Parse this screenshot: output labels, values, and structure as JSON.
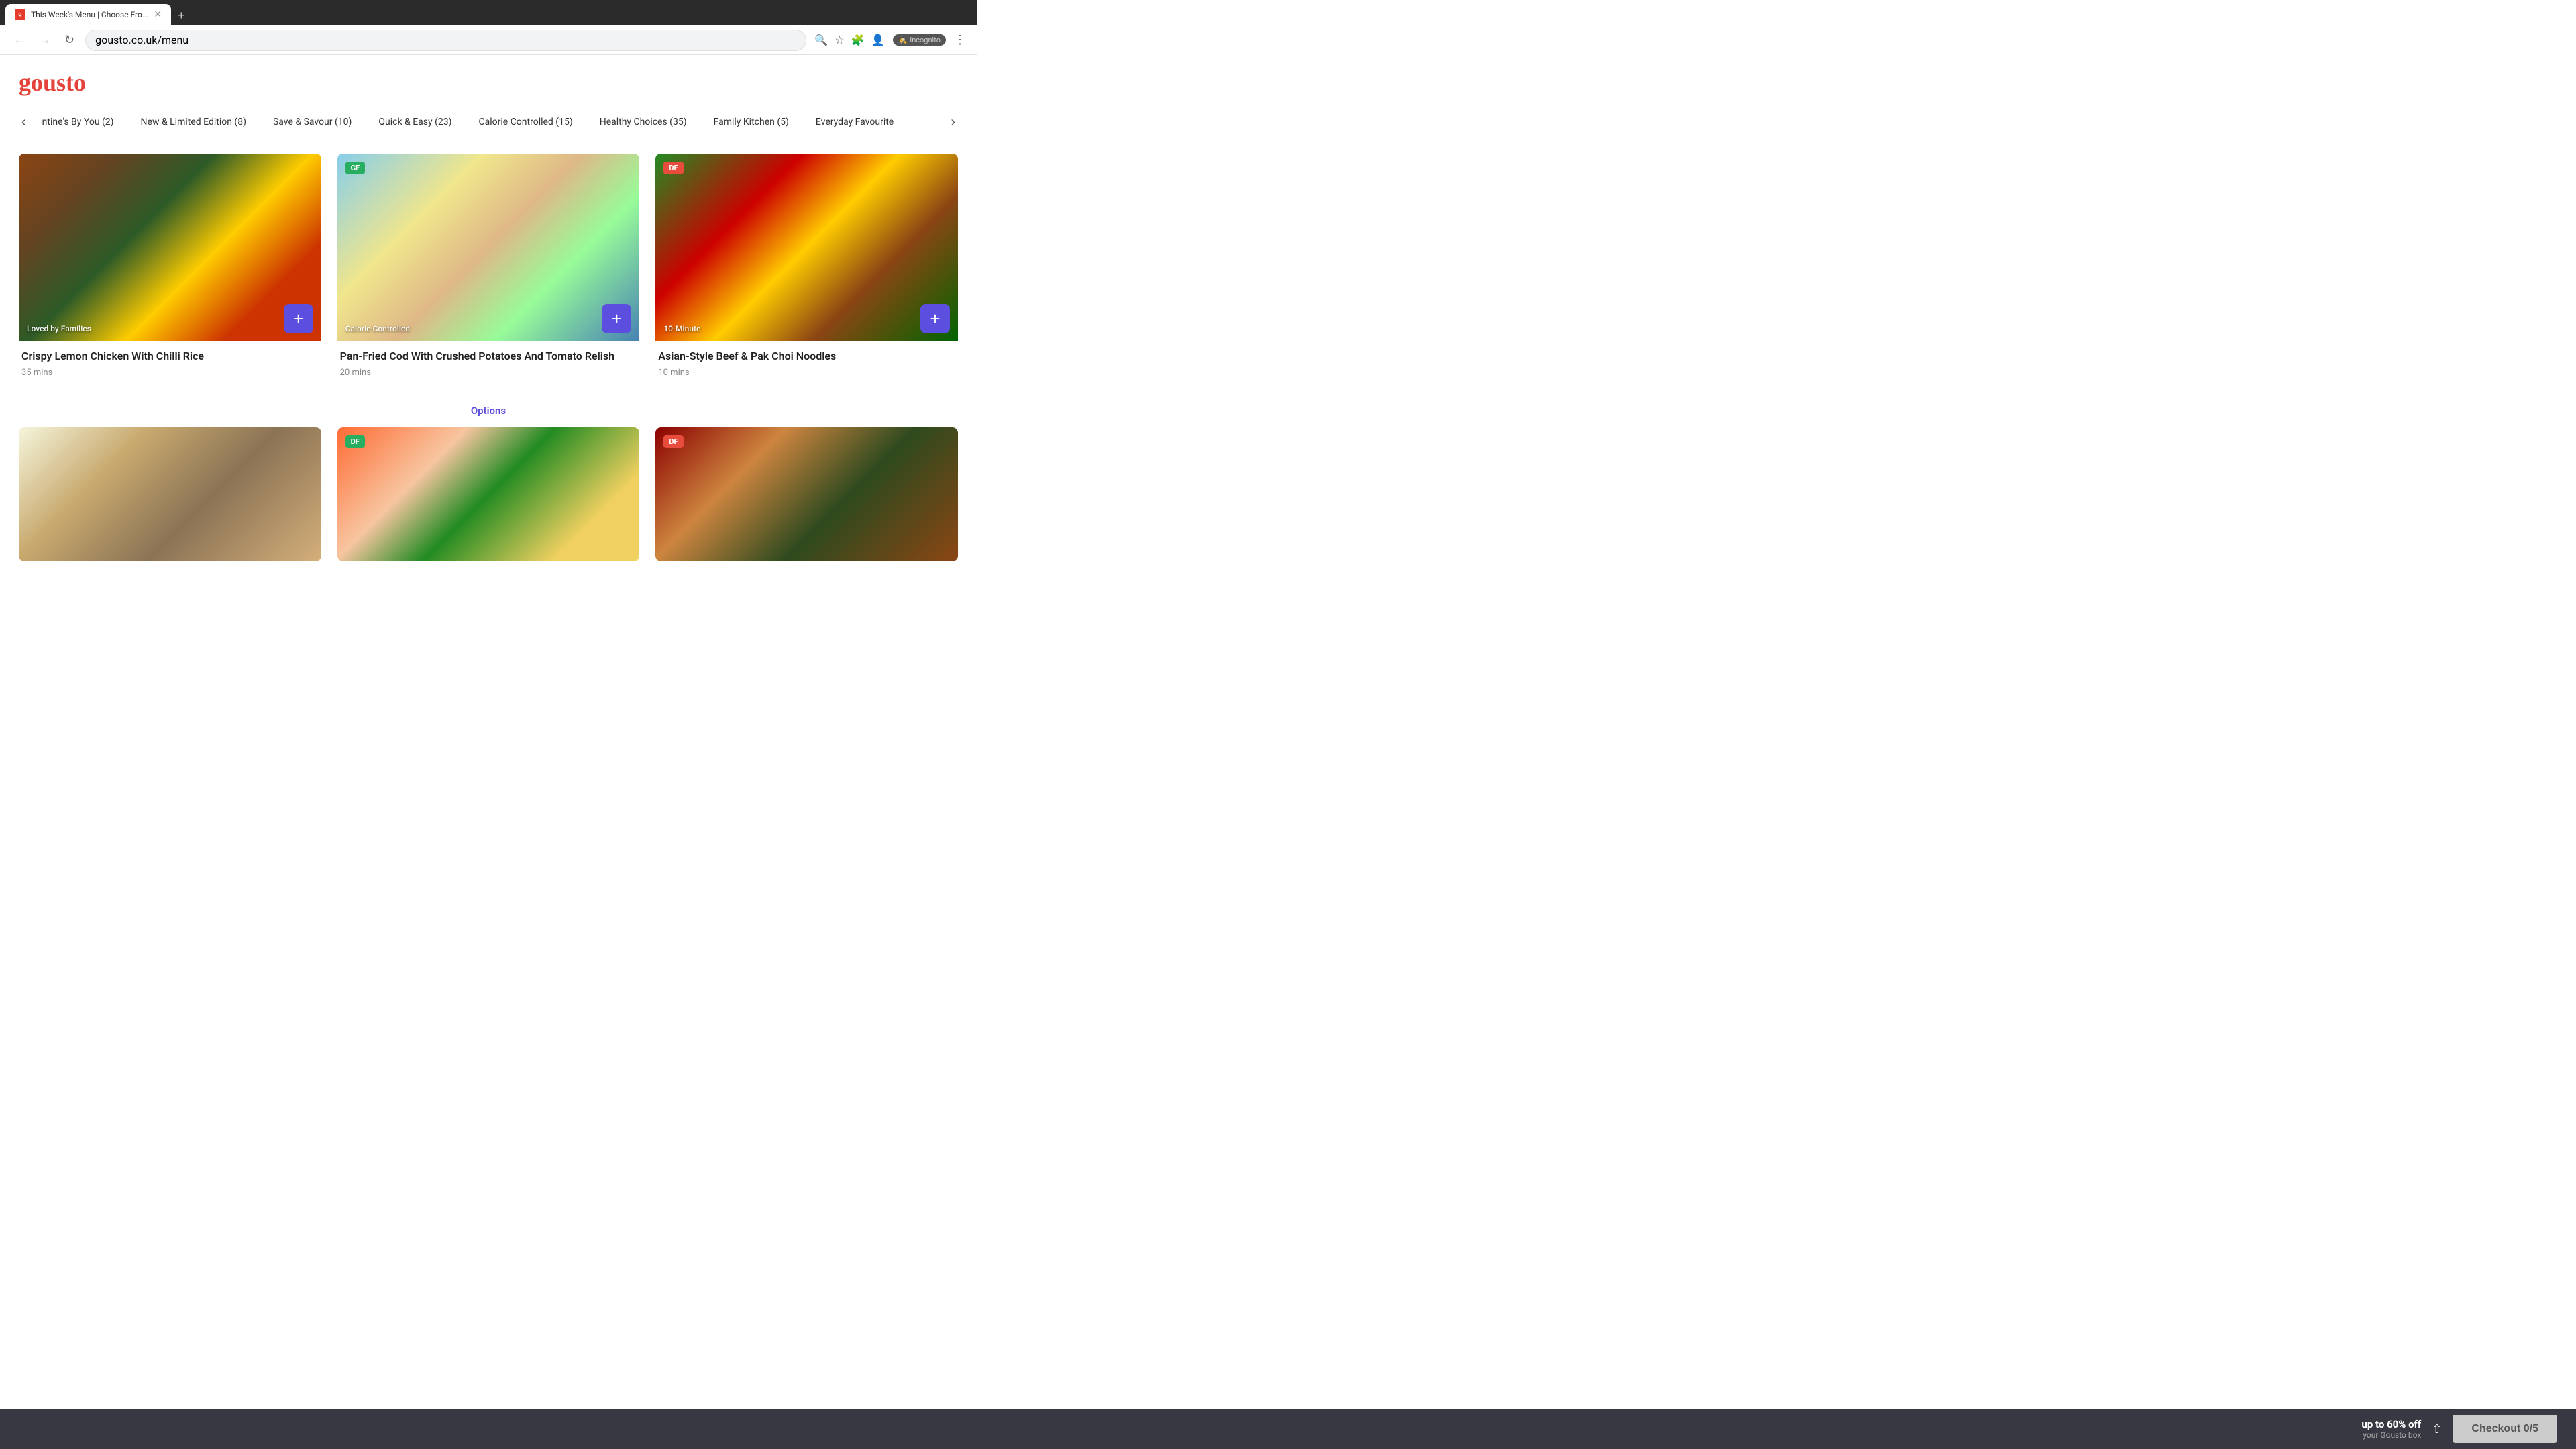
{
  "browser": {
    "tab_title": "This Week's Menu | Choose Fro...",
    "url": "gousto.co.uk/menu",
    "incognito_label": "Incognito",
    "new_tab_label": "+"
  },
  "header": {
    "logo": "gousto"
  },
  "categories": [
    {
      "label": "ntine's By You (2)",
      "count": 2
    },
    {
      "label": "New & Limited Edition (8)",
      "count": 8
    },
    {
      "label": "Save & Savour (10)",
      "count": 10
    },
    {
      "label": "Quick & Easy (23)",
      "count": 23
    },
    {
      "label": "Calorie Controlled (15)",
      "count": 15
    },
    {
      "label": "Healthy Choices (35)",
      "count": 35
    },
    {
      "label": "Family Kitchen (5)",
      "count": 5
    },
    {
      "label": "Everyday Favourite",
      "count": null
    }
  ],
  "meals": [
    {
      "id": 1,
      "title": "Crispy Lemon Chicken With Chilli Rice",
      "time": "35 mins",
      "category_tag": "Loved by Families",
      "badge": null,
      "img_class": "img-1"
    },
    {
      "id": 2,
      "title": "Pan-Fried Cod With Crushed Potatoes And Tomato Relish",
      "time": "20 mins",
      "category_tag": "Calorie Controlled",
      "badge": "GF",
      "badge_type": "gf-badge",
      "img_class": "img-2"
    },
    {
      "id": 3,
      "title": "Asian-Style Beef & Pak Choi Noodles",
      "time": "10 mins",
      "category_tag": "10-Minute",
      "badge": "DF",
      "badge_type": "df-badge",
      "img_class": "img-3"
    }
  ],
  "bottom_meals": [
    {
      "id": 4,
      "img_class": "img-4",
      "badge": null
    },
    {
      "id": 5,
      "img_class": "img-5",
      "badge": "DF",
      "badge_type": "gf-badge"
    },
    {
      "id": 6,
      "img_class": "img-6",
      "badge": "DF",
      "badge_type": "df-badge"
    }
  ],
  "options_label": "Options",
  "bottom_bar": {
    "discount_main": "up to 60% off",
    "discount_sub": "your Gousto box",
    "checkout_label": "Checkout",
    "cart_count": "0/5"
  }
}
